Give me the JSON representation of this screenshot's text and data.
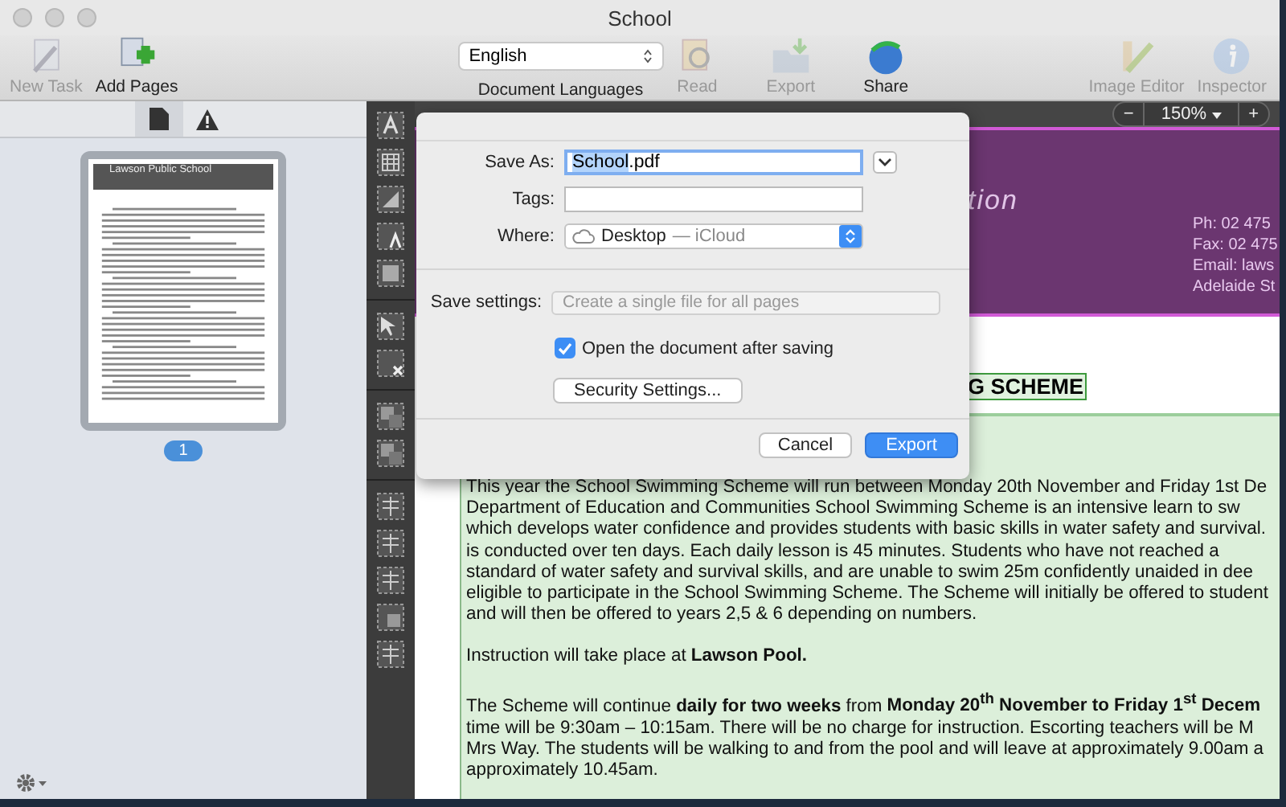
{
  "window": {
    "title": "School"
  },
  "toolbar": {
    "items": [
      {
        "label": "New Task",
        "kind": "task",
        "disabled": true
      },
      {
        "label": "Add Pages",
        "kind": "add",
        "disabled": false
      }
    ],
    "language": {
      "value": "English",
      "label": "Document Languages"
    },
    "center_items": [
      {
        "label": "Read",
        "kind": "read",
        "disabled": true
      },
      {
        "label": "Export",
        "kind": "export",
        "disabled": true
      },
      {
        "label": "Share",
        "kind": "share",
        "disabled": false
      }
    ],
    "right_items": [
      {
        "label": "Image Editor",
        "kind": "editor",
        "disabled": true
      },
      {
        "label": "Inspector",
        "kind": "info",
        "disabled": true
      }
    ]
  },
  "sidebar": {
    "tabs": [
      {
        "kind": "page",
        "selected": true
      },
      {
        "kind": "warning",
        "selected": false
      }
    ],
    "thumbnail": {
      "school_name": "Lawson Public School",
      "page_number": "1",
      "selected": true
    }
  },
  "zoom": {
    "minus": "−",
    "value": "150%",
    "plus": "+"
  },
  "document": {
    "header_title": "tion",
    "contact_lines": [
      "Ph:  02 475",
      "Fax: 02 475",
      "Email: laws",
      "Adelaide St"
    ],
    "heading": "G SCHEME",
    "paragraphs": [
      {
        "lines": [
          "This year the School Swimming Scheme will run between Monday 20th November and Friday 1st De",
          "Department of Education and Communities School Swimming Scheme is an intensive learn to sw",
          "which develops water confidence and provides students with basic skills in water safety and survival.",
          "is conducted over ten days. Each daily lesson is 45 minutes. Students who have not reached a",
          "standard of water safety and survival skills, and are unable to swim 25m confidently unaided in dee",
          "eligible to participate in the School Swimming Scheme. The Scheme will initially be offered to student",
          "and will then be offered to years 2,5 & 6 depending on numbers."
        ]
      },
      {
        "lines": [
          "Instruction will take place at **Lawson Pool.**"
        ]
      },
      {
        "lines": [
          "The Scheme will continue **daily for two weeks** from **Monday 20$^{th}$ November to Friday 1$^{st}$ Decem**",
          "time will be 9:30am – 10:15am. There will be no charge for instruction. Escorting teachers will be M",
          "Mrs Way. The students will be walking to and from the pool and will leave at approximately 9.00am a",
          "approximately 10.45am."
        ]
      }
    ]
  },
  "dialog": {
    "save_as": {
      "label": "Save As:",
      "value_parts": [
        {
          "text": "School",
          "selected": true
        },
        {
          "text": ".pdf",
          "selected": false
        }
      ]
    },
    "tags": {
      "label": "Tags:"
    },
    "where": {
      "label": "Where:",
      "folder": "Desktop",
      "location": "— iCloud"
    },
    "save_settings": {
      "label": "Save settings:",
      "value": "Create a single file for all pages",
      "disabled": true
    },
    "open_after": {
      "label": "Open the document after saving",
      "checked": true
    },
    "security_button": "Security Settings...",
    "buttons": [
      {
        "label": "Cancel",
        "default": false
      },
      {
        "label": "Export",
        "default": true
      }
    ]
  }
}
